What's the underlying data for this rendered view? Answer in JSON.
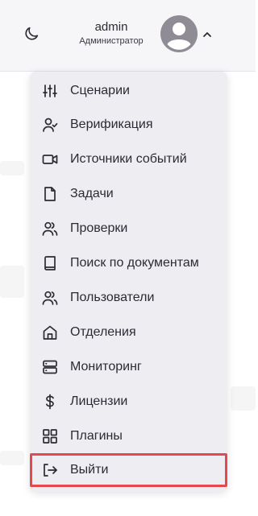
{
  "header": {
    "user_name": "admin",
    "user_role": "Администратор"
  },
  "menu": {
    "items": [
      {
        "label": "Сценарии",
        "icon": "sliders-icon"
      },
      {
        "label": "Верификация",
        "icon": "user-check-icon"
      },
      {
        "label": "Источники событий",
        "icon": "video-camera-icon"
      },
      {
        "label": "Задачи",
        "icon": "file-icon"
      },
      {
        "label": "Проверки",
        "icon": "users-icon"
      },
      {
        "label": "Поиск по документам",
        "icon": "book-icon"
      },
      {
        "label": "Пользователи",
        "icon": "users-icon"
      },
      {
        "label": "Отделения",
        "icon": "home-icon"
      },
      {
        "label": "Мониторинг",
        "icon": "server-icon"
      },
      {
        "label": "Лицензии",
        "icon": "dollar-icon"
      },
      {
        "label": "Плагины",
        "icon": "grid-icon"
      },
      {
        "label": "Выйти",
        "icon": "logout-icon"
      }
    ]
  },
  "colors": {
    "highlight": "#e5484d",
    "menu_bg": "#eeedf2",
    "avatar": "#8f8c96"
  }
}
